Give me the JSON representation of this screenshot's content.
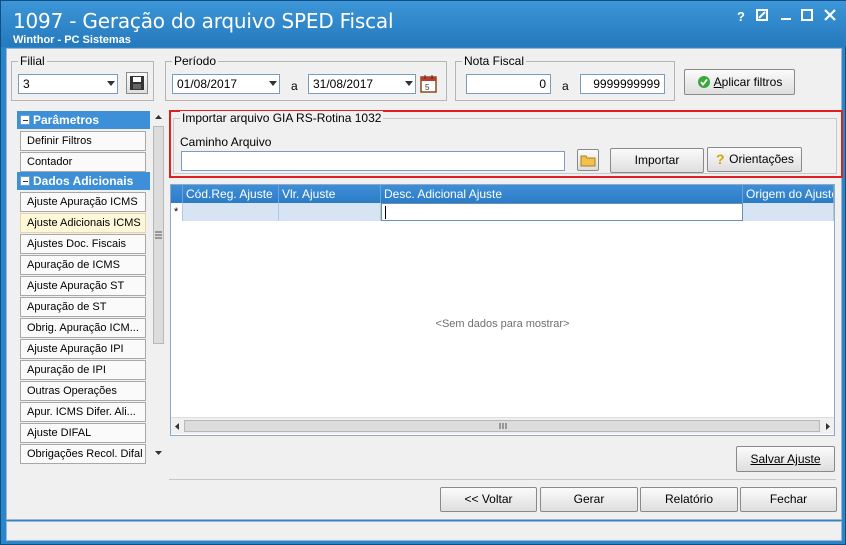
{
  "window": {
    "title": "1097 - Geração do arquivo SPED Fiscal",
    "subtitle": "Winthor - PC Sistemas",
    "controls": {
      "help": "?",
      "restore": "◩",
      "minimize": "▭",
      "close": "✕"
    }
  },
  "filial": {
    "label": "Filial",
    "value": "3"
  },
  "periodo": {
    "label": "Período",
    "start": "01/08/2017",
    "sep": "a",
    "end": "31/08/2017"
  },
  "nota_fiscal": {
    "label": "Nota Fiscal",
    "start": "0",
    "sep": "a",
    "end": "9999999999"
  },
  "aplicar_filtros": {
    "label": "Aplicar filtros",
    "shortcut": "A",
    "rest": "plicar filtros"
  },
  "sidebar": {
    "groups": [
      {
        "label": "Parâmetros",
        "items": [
          "Definir Filtros",
          "Contador"
        ]
      },
      {
        "label": "Dados Adicionais",
        "items": [
          "Ajuste Apuração ICMS",
          "Ajuste Adicionais ICMS",
          "Ajustes Doc. Fiscais",
          "Apuração de ICMS",
          "Ajuste Apuração ST",
          "Apuração de ST",
          "Obrig. Apuração ICM...",
          "Ajuste Apuração IPI",
          "Apuração de IPI",
          "Outras Operações",
          "Apur. ICMS Difer. Ali...",
          "Ajuste DIFAL",
          "Obrigações Recol. Difal"
        ]
      }
    ],
    "selected": "Ajuste Adicionais ICMS"
  },
  "importar": {
    "group_label": "Importar arquivo GIA RS-Rotina 1032",
    "path_label": "Caminho Arquivo",
    "path_value": "",
    "import_button": "Importar",
    "orient_button": "Orientações"
  },
  "grid": {
    "columns": [
      "Cód.Reg. Ajuste",
      "Vlr. Ajuste",
      "Desc. Adicional Ajuste",
      "Origem do Ajuste"
    ],
    "new_row_marker": "*",
    "empty_text": "<Sem dados para mostrar>"
  },
  "buttons": {
    "salvar": "Salvar Ajuste",
    "voltar": "<< Voltar",
    "gerar": "Gerar",
    "relatorio": "Relatório",
    "fechar": "Fechar"
  },
  "colors": {
    "accent": "#2a85c9",
    "highlight_border": "#e02020",
    "grid_header": "#3e8fd6"
  }
}
